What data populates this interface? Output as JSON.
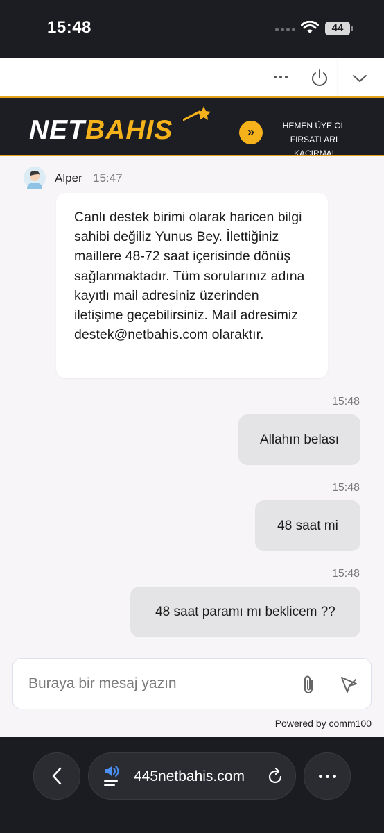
{
  "status_bar": {
    "time": "15:48",
    "battery": "44"
  },
  "banner": {
    "brand_first": "NET",
    "brand_second": "BAHIS",
    "cta_line1": "HEMEN ÜYE OL",
    "cta_line2": "FIRSATLARI KAÇIRMA!"
  },
  "agent": {
    "name": "Alper",
    "time": "15:47"
  },
  "agent_message": "Canlı destek birimi olarak haricen bilgi sahibi değiliz Yunus Bey. İlettiğiniz maillere 48-72 saat içerisinde dönüş sağlanmaktadır. Tüm sorularınız adına kayıtlı mail adresiniz üzerinden iletişime geçebilirsiniz. Mail adresimiz destek@netbahis.com olaraktır.",
  "visitor_messages": [
    {
      "time": "15:48",
      "text": "Allahın belası"
    },
    {
      "time": "15:48",
      "text": "48 saat mi"
    },
    {
      "time": "15:48",
      "text": "48 saat paramı mı beklicem ??"
    }
  ],
  "composer": {
    "placeholder": "Buraya bir mesaj yazın",
    "value": ""
  },
  "powered_by": "Powered by comm100",
  "browser": {
    "url": "445netbahis.com"
  },
  "colors": {
    "brand_accent": "#f6b21b",
    "dark_bar": "#1c1d22",
    "visitor_bubble": "#e4e4e6"
  }
}
